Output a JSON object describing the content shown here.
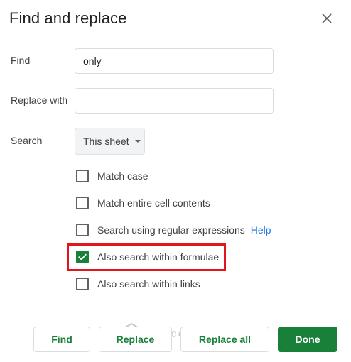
{
  "dialog": {
    "title": "Find and replace",
    "close_icon": "close-icon"
  },
  "fields": {
    "find_label": "Find",
    "find_value": "only",
    "replace_label": "Replace with",
    "replace_value": "",
    "search_label": "Search",
    "search_selected": "This sheet"
  },
  "options": [
    {
      "label": "Match case",
      "checked": false
    },
    {
      "label": "Match entire cell contents",
      "checked": false
    },
    {
      "label": "Search using regular expressions",
      "checked": false,
      "help": "Help"
    },
    {
      "label": "Also search within formulae",
      "checked": true
    },
    {
      "label": "Also search within links",
      "checked": false
    }
  ],
  "buttons": {
    "find": "Find",
    "replace": "Replace",
    "replace_all": "Replace all",
    "done": "Done"
  },
  "watermark": "OfficeWheel",
  "colors": {
    "accent_green": "#188038",
    "link_blue": "#1a73e8",
    "highlight_red": "#e0161c"
  }
}
